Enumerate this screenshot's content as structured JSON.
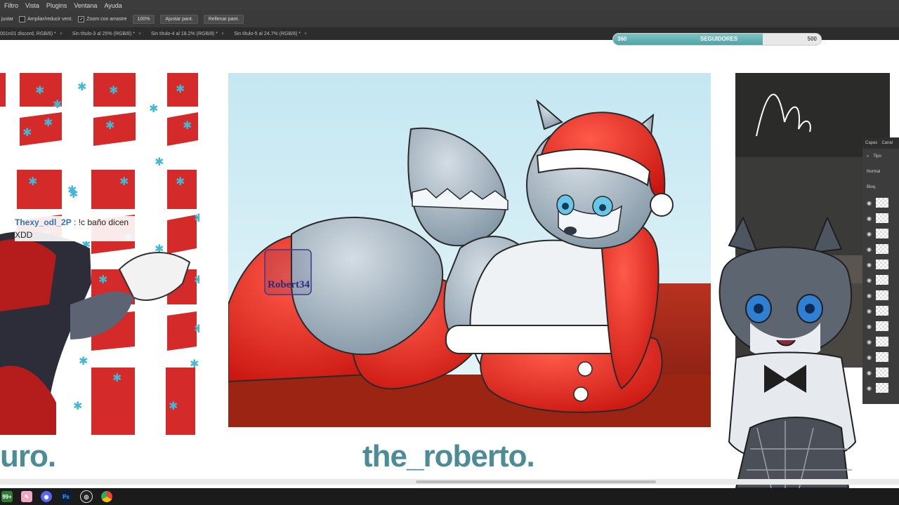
{
  "menu": [
    "Filtro",
    "Vista",
    "Plugins",
    "Ventana",
    "Ayuda"
  ],
  "options": {
    "adjust_label": "justar",
    "resize_windows": "Ampliar/reducir vent.",
    "scrubby_zoom": "Zoom con arrastre",
    "zoom_value": "100%",
    "fit_screen": "Ajustar pant.",
    "fill_screen": "Rellenar pant."
  },
  "tabs": [
    "001n01 discord, RGB/8) *",
    "Sin título-3 al 25% (RGB/8) *",
    "Sin título-4 al 18.2% (RGB/8) *",
    "Sin título-5 al 24.7% (RGB/8) *"
  ],
  "followers": {
    "current": "360",
    "label": "SEGUIDORES",
    "goal": "500",
    "progress": 0.72,
    "accent": "#4fa3a6"
  },
  "chat": {
    "user": "Thexy_odl_2P",
    "message": ": !c baño dicen XDD"
  },
  "watermark": "Robert34",
  "names": {
    "left": "uro.",
    "center": "the_roberto."
  },
  "layers_panel": {
    "tab1": "Capas",
    "tab2": "Canal",
    "search": "Tipo",
    "blend": "Normal",
    "lock": "Bloq."
  },
  "taskbar_icons": [
    "windows-icon",
    "notes-icon",
    "discord-icon",
    "photoshop-icon",
    "obs-icon",
    "chrome-icon"
  ]
}
